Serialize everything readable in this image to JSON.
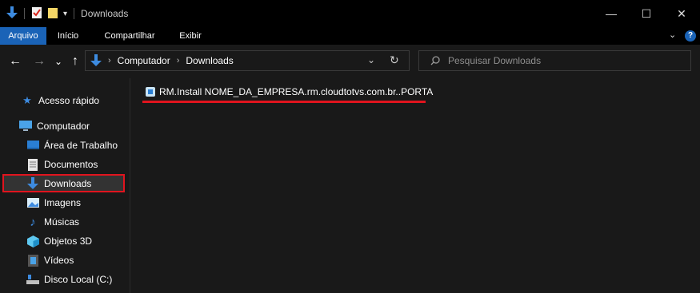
{
  "window": {
    "title": "Downloads",
    "controls": {
      "minimize": "—",
      "maximize": "☐",
      "close": "✕"
    }
  },
  "ribbon": {
    "tabs": [
      {
        "label": "Arquivo",
        "active": true
      },
      {
        "label": "Início",
        "active": false
      },
      {
        "label": "Compartilhar",
        "active": false
      },
      {
        "label": "Exibir",
        "active": false
      }
    ],
    "expand_icon": "chevron-down-icon",
    "help_icon": "help-icon"
  },
  "nav": {
    "back": "←",
    "forward": "→",
    "recent": "⌄",
    "up": "↑",
    "breadcrumb": [
      "Computador",
      "Downloads"
    ],
    "refresh": "↻",
    "dropdown": "⌄"
  },
  "search": {
    "placeholder": "Pesquisar Downloads"
  },
  "sidebar": {
    "items": [
      {
        "label": "Acesso rápido",
        "icon": "star-icon"
      },
      {
        "label": "Computador",
        "icon": "computer-icon"
      },
      {
        "label": "Área de Trabalho",
        "icon": "desktop-icon"
      },
      {
        "label": "Documentos",
        "icon": "document-icon"
      },
      {
        "label": "Downloads",
        "icon": "download-icon",
        "selected": true
      },
      {
        "label": "Imagens",
        "icon": "image-icon"
      },
      {
        "label": "Músicas",
        "icon": "music-icon"
      },
      {
        "label": "Objetos 3D",
        "icon": "cube-icon"
      },
      {
        "label": "Vídeos",
        "icon": "video-icon"
      },
      {
        "label": "Disco Local (C:)",
        "icon": "drive-icon"
      }
    ]
  },
  "files": [
    {
      "name": "RM.Install NOME_DA_EMPRESA.rm.cloudtotvs.com.br..PORTA",
      "icon": "installer-icon"
    }
  ],
  "colors": {
    "accent": "#1a63b7",
    "highlight_border": "#e0141e",
    "background": "#191919",
    "titlebar": "#000000"
  }
}
